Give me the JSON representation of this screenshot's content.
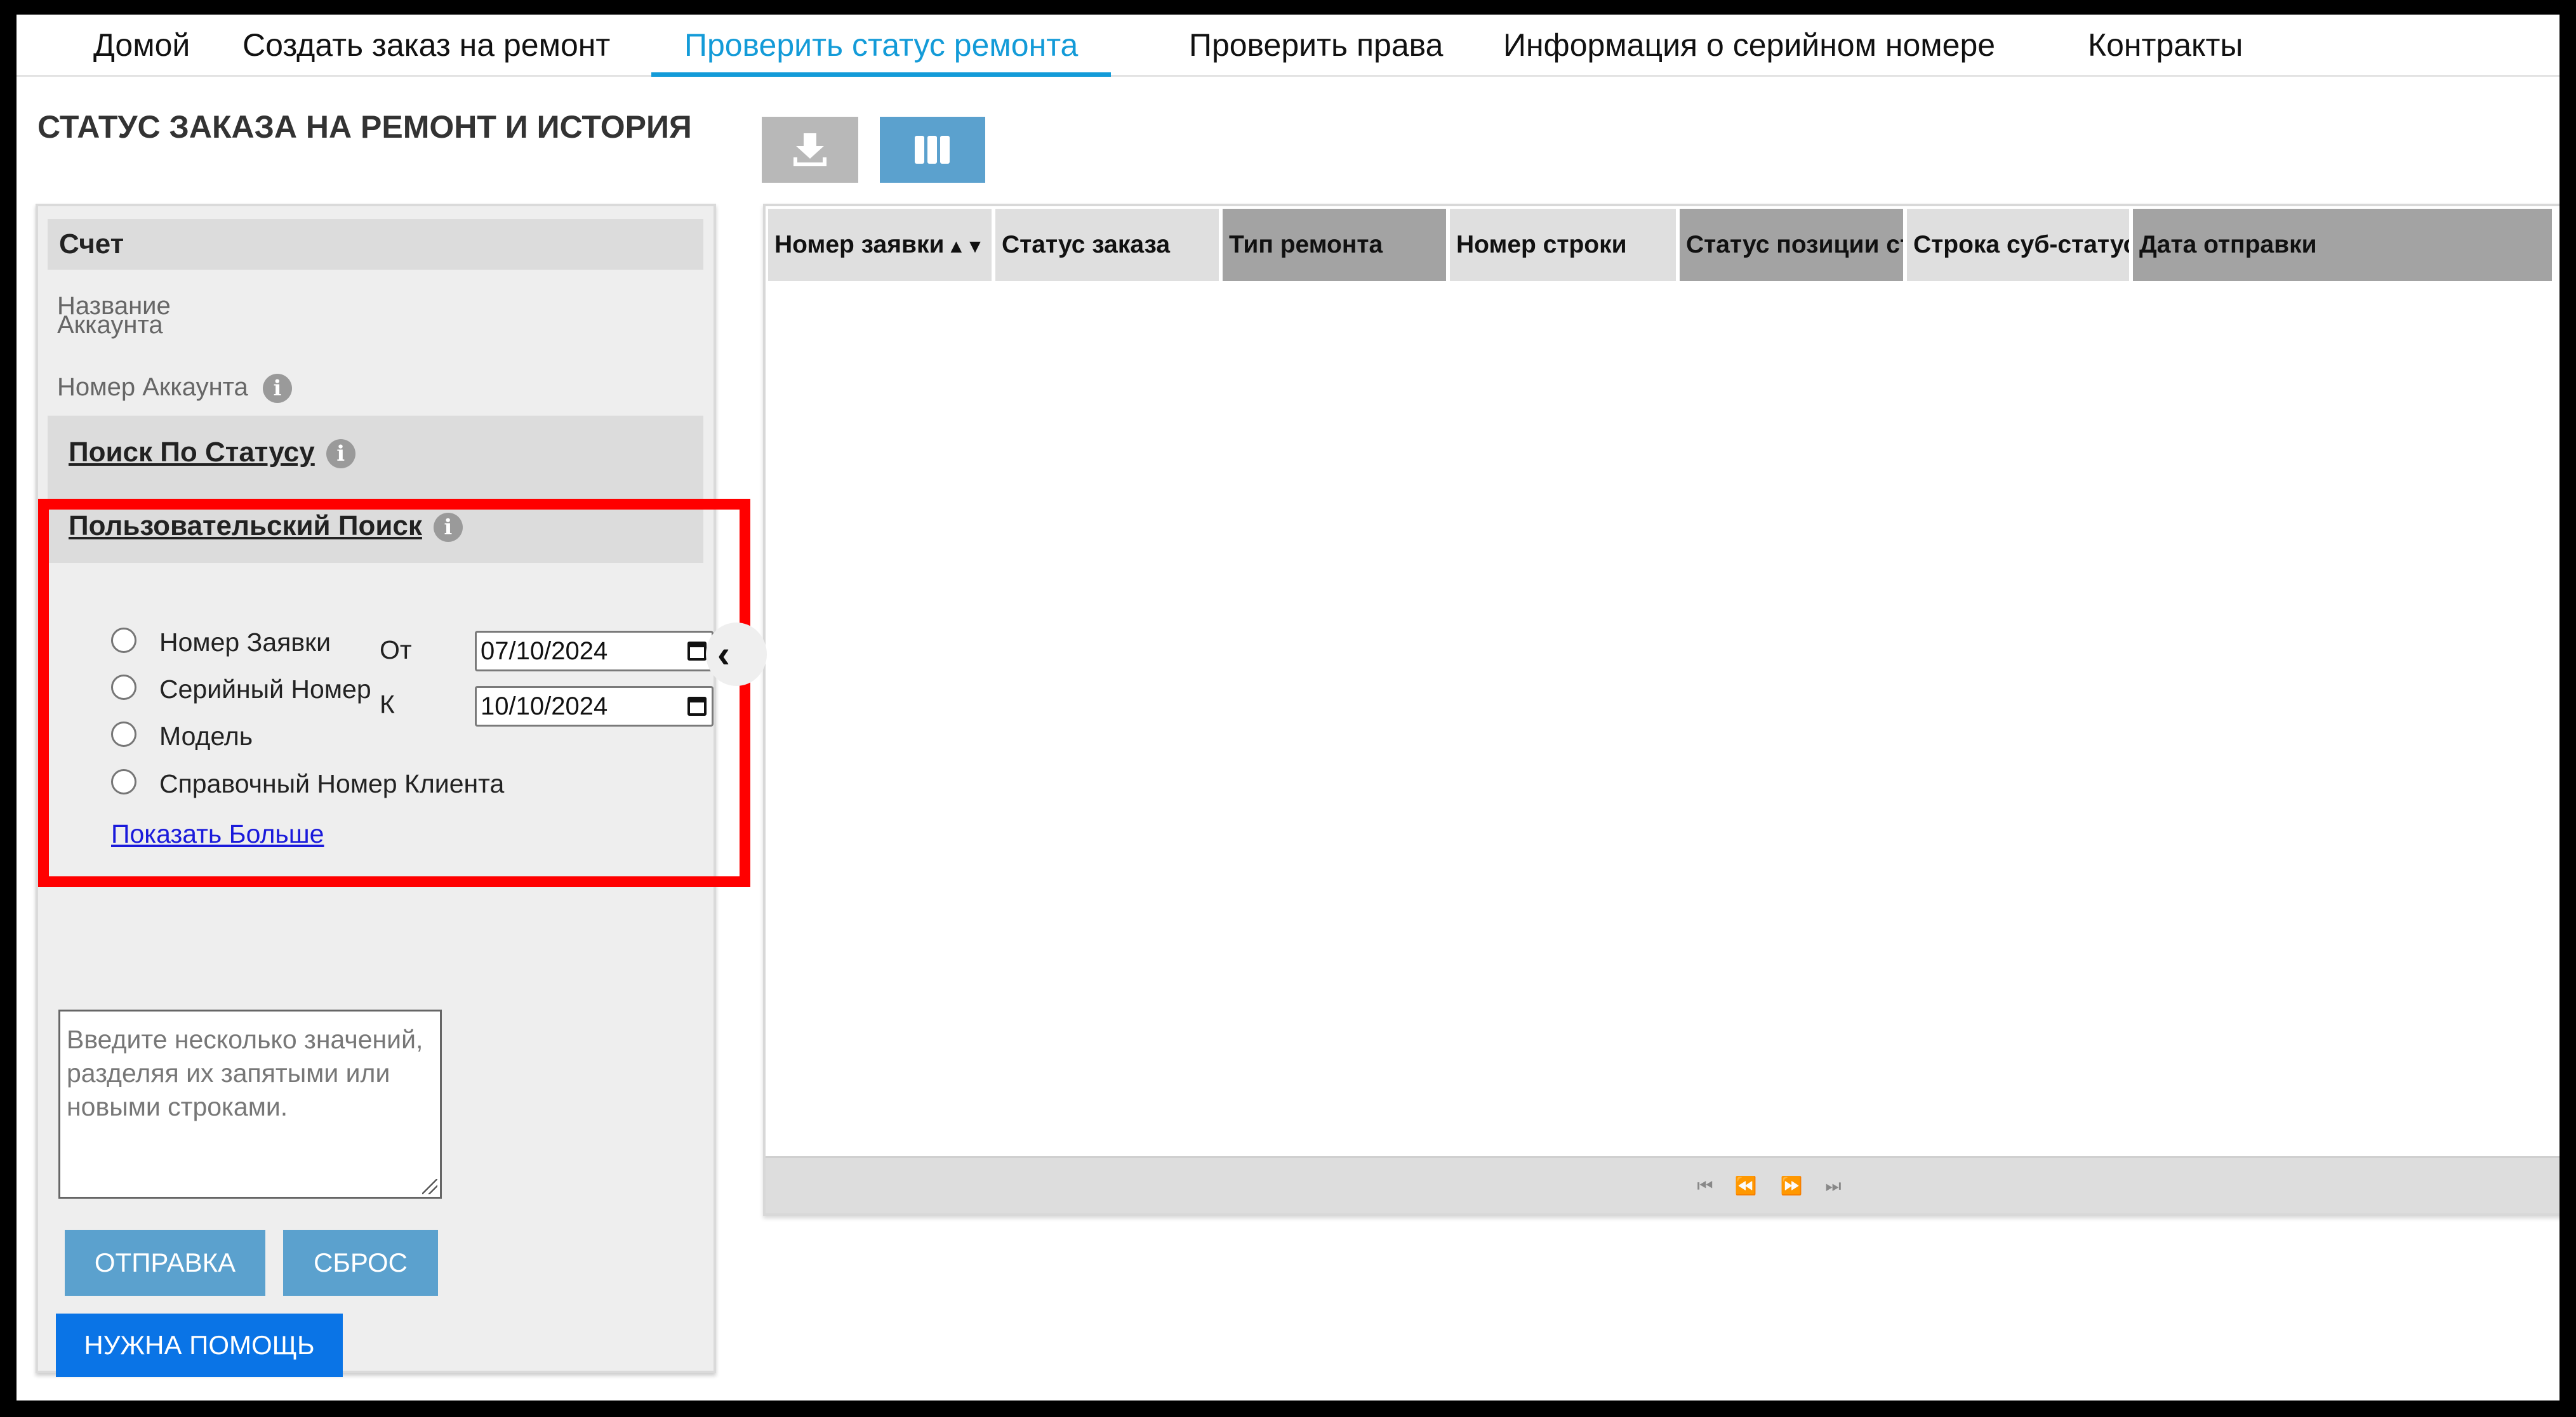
{
  "nav": {
    "items": [
      {
        "label": "Домой"
      },
      {
        "label": "Создать заказ на ремонт"
      },
      {
        "label": "Проверить статус ремонта"
      },
      {
        "label": "Проверить права"
      },
      {
        "label": "Информация о серийном номере"
      },
      {
        "label": "Контракты"
      }
    ],
    "active_index": 2,
    "accent_color": "#139bd8"
  },
  "page": {
    "title": "СТАТУС ЗАКАЗА НА РЕМОНТ И ИСТОРИЯ"
  },
  "account": {
    "header": "Счет",
    "name_label_line1": "Название",
    "name_label_line2": "Аккаунта",
    "number_label": "Номер Аккаунта"
  },
  "search": {
    "status_search_label": "Поиск По Статусу",
    "custom_search_label": "Пользовательский Поиск",
    "options": [
      {
        "label": "Номер Заявки"
      },
      {
        "label": "Серийный Номер"
      },
      {
        "label": "Модель"
      },
      {
        "label": "Справочный Номер Клиента"
      }
    ],
    "from_label": "От",
    "to_label": "К",
    "from_date": "07/10/2024",
    "to_date": "10/10/2024",
    "show_more": "Показать Больше",
    "textarea_placeholder": "Введите несколько значений, разделяя их запятыми или новыми строками.",
    "submit_label": "ОТПРАВКА",
    "reset_label": "СБРОС",
    "help_label": "НУЖНА ПОМОЩЬ",
    "highlight_color": "#ff0000"
  },
  "grid": {
    "columns": [
      {
        "label": "Номер заявки",
        "sort": "▲▼"
      },
      {
        "label": "Статус заказа"
      },
      {
        "label": "Тип ремонта"
      },
      {
        "label": "Номер строки"
      },
      {
        "label": "Статус позиции ст"
      },
      {
        "label": "Строка суб-статуса"
      },
      {
        "label": "Дата отправки"
      }
    ]
  },
  "icons": {
    "info": "info-icon",
    "download": "download-icon",
    "columns": "columns-icon",
    "collapse": "chevron-left-icon",
    "calendar": "calendar-icon",
    "pager": [
      "first-page-icon",
      "prev-page-icon",
      "next-page-icon",
      "last-page-icon"
    ]
  }
}
